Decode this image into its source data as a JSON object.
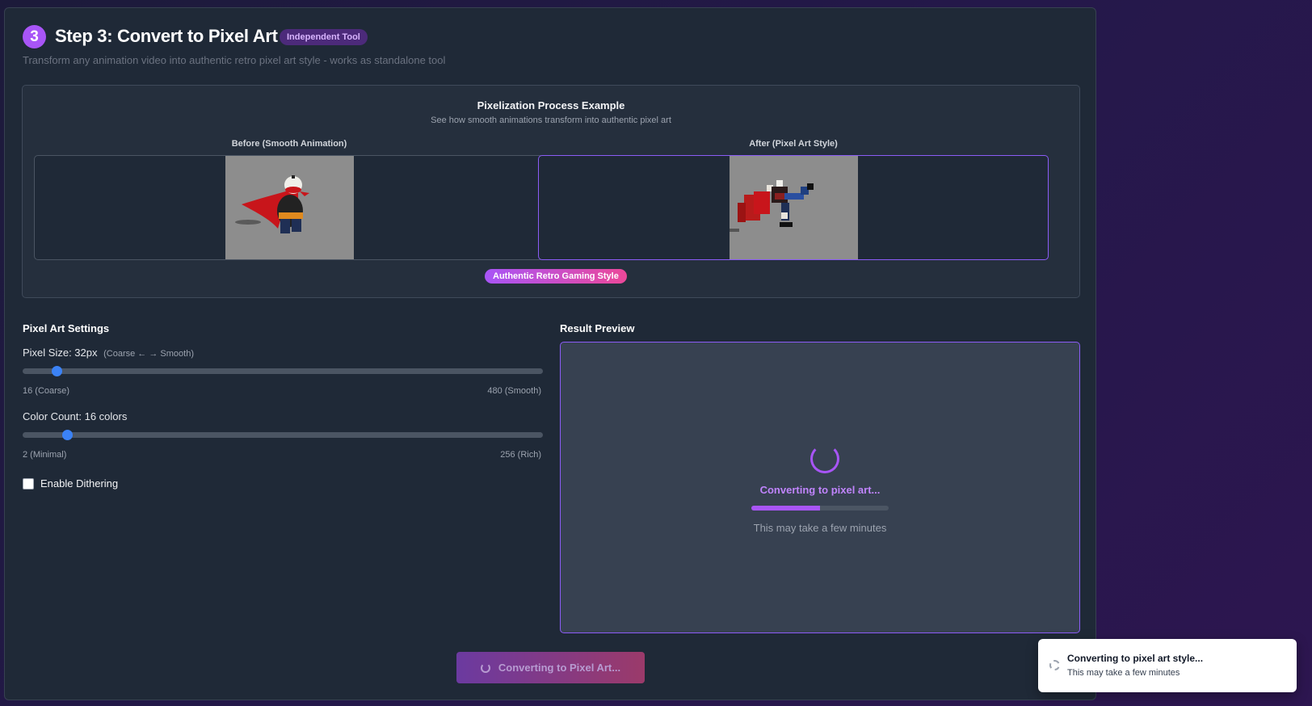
{
  "header": {
    "step_number": "3",
    "title": "Step 3: Convert to Pixel Art",
    "tag": "Independent Tool",
    "subtitle": "Transform any animation video into authentic retro pixel art style - works as standalone tool"
  },
  "example": {
    "title": "Pixelization Process Example",
    "subtitle": "See how smooth animations transform into authentic pixel art",
    "before_caption": "Before (Smooth Animation)",
    "after_caption": "After (Pixel Art Style)",
    "style_pill": "Authentic Retro Gaming Style"
  },
  "settings": {
    "title": "Pixel Art Settings",
    "pixel_size": {
      "label": "Pixel Size: 32px",
      "hint": "(Coarse ← → Smooth)",
      "min_label": "16 (Coarse)",
      "max_label": "480 (Smooth)",
      "value": 32,
      "min": 16,
      "max": 480
    },
    "color_count": {
      "label": "Color Count: 16 colors",
      "min_label": "2 (Minimal)",
      "max_label": "256 (Rich)",
      "value": 16,
      "min": 2,
      "max": 256
    },
    "dithering_label": "Enable Dithering",
    "dithering_checked": false
  },
  "preview": {
    "title": "Result Preview",
    "status": "Converting to pixel art...",
    "progress_fraction": 0.5,
    "note": "This may take a few minutes"
  },
  "action_button": "Converting to Pixel Art...",
  "toast": {
    "title": "Converting to pixel art style...",
    "message": "This may take a few minutes"
  },
  "colors": {
    "accent": "#a855f7",
    "slider_thumb": "#3b82f6",
    "pill_gradient_end": "#ec4899"
  }
}
